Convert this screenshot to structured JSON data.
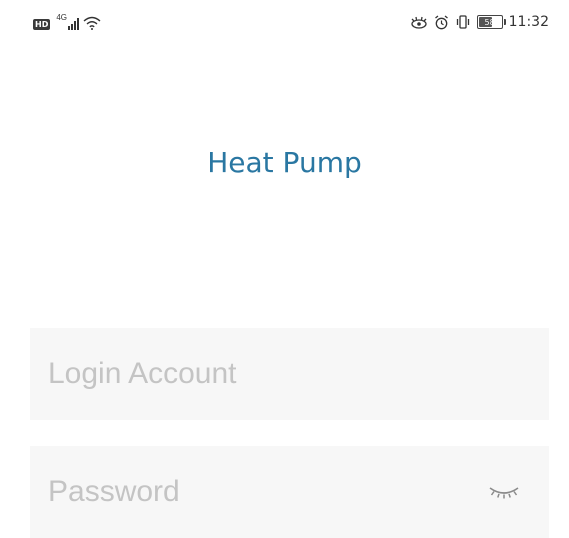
{
  "status_bar": {
    "hd_label": "HD",
    "network_type": "4G",
    "battery_level": "58",
    "time": "11:32",
    "icons": [
      "hd-icon",
      "signal-icon",
      "wifi-icon",
      "eye-icon",
      "alarm-icon",
      "vibrate-icon",
      "battery-icon"
    ]
  },
  "app": {
    "title": "Heat Pump"
  },
  "login": {
    "account_placeholder": "Login Account",
    "account_value": "",
    "password_placeholder": "Password",
    "password_value": "",
    "password_toggle_icon": "eye-closed-icon"
  },
  "colors": {
    "title": "#2a77a2",
    "field_bg": "#f7f7f7",
    "placeholder": "#c4c4c4"
  }
}
